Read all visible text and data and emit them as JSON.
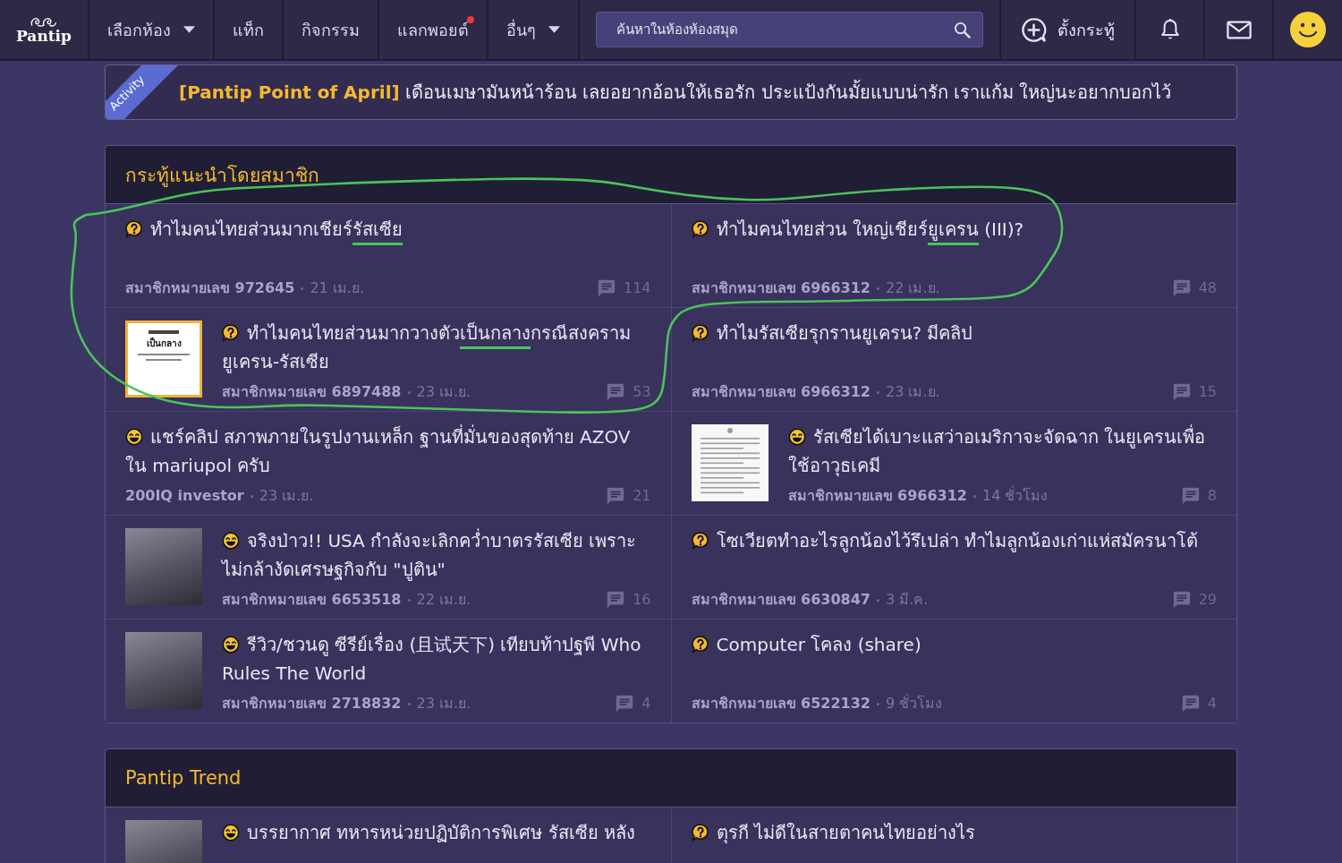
{
  "nav": {
    "logo": "Pantip",
    "items": [
      {
        "label": "เลือกห้อง",
        "dropdown": true,
        "notification": false
      },
      {
        "label": "แท็ก",
        "dropdown": false,
        "notification": false
      },
      {
        "label": "กิจกรรม",
        "dropdown": false,
        "notification": false
      },
      {
        "label": "แลกพอยต์",
        "dropdown": false,
        "notification": true
      },
      {
        "label": "อื่นๆ",
        "dropdown": true,
        "notification": false
      }
    ],
    "search": {
      "placeholder": "ค้นหาในห้องห้องสมุด"
    },
    "new_post": "ตั้งกระทู้"
  },
  "banner": {
    "ribbon": "Activity",
    "text": "**[Pantip Point of April]** เดือนเมษามันหน้าร้อน เลยอยากอ้อนให้เธอรัก ประแป้งกันมั้ยแบบน่ารัก เราแก้ม ใหญ่นะอยากบอกไว้"
  },
  "sections": [
    {
      "title": "กระทู้แนะนำโดยสมาชิก",
      "hand_drawn_loop": true,
      "posts": [
        {
          "kind": "question",
          "title": [
            {
              "text": "ทำไมคนไทยส่วนมากเชียร์",
              "underlined": false
            },
            {
              "text": "รัสเซีย",
              "underlined": true
            }
          ],
          "author": "สมาชิกหมายเลข 972645",
          "time": "21 เม.ย.",
          "comments": "114"
        },
        {
          "kind": "question",
          "title": [
            {
              "text": "ทำไมคนไทยส่วน ใหญ่เชียร์",
              "underlined": false
            },
            {
              "text": "ยูเครน",
              "underlined": true
            },
            {
              "text": " (III)?",
              "underlined": false
            }
          ],
          "author": "สมาชิกหมายเลข 6966312",
          "time": "22 เม.ย.",
          "comments": "48"
        },
        {
          "kind": "question",
          "thumbnail": {
            "kind": "poster",
            "heading": "เป็นกลาง"
          },
          "title": [
            {
              "text": "ทำไมคนไทยส่วนมากวางตัว",
              "underlined": false
            },
            {
              "text": "เป็นกลาง",
              "underlined": true
            },
            {
              "text": "กรณีสงครามยูเครน-รัสเซีย",
              "underlined": false
            }
          ],
          "author": "สมาชิกหมายเลข 6897488",
          "time": "23 เม.ย.",
          "comments": "53"
        },
        {
          "kind": "question",
          "title": [
            {
              "text": "ทำไมรัสเซียรุกรานยูเครน? มีคลิป",
              "underlined": false
            }
          ],
          "author": "สมาชิกหมายเลข 6966312",
          "time": "23 เม.ย.",
          "comments": "15"
        },
        {
          "kind": "chat",
          "title": [
            {
              "text": "แชร์คลิป สภาพภายในรูปงานเหล็ก ฐานที่มั่นของสุดท้าย AZOV ใน mariupol ครับ",
              "underlined": false
            }
          ],
          "author": "200IQ investor",
          "time": "23 เม.ย.",
          "comments": "21"
        },
        {
          "kind": "chat",
          "thumbnail": {
            "kind": "document"
          },
          "title": [
            {
              "text": "รัสเซียได้เบาะแสว่าอเมริกาจะจัดฉาก ในยูเครนเพื่อใช้อาวุธเคมี",
              "underlined": false
            }
          ],
          "author": "สมาชิกหมายเลข 6966312",
          "time": "14 ชั่วโมง",
          "comments": "8"
        },
        {
          "kind": "chat",
          "thumbnail": {
            "kind": "photo"
          },
          "title": [
            {
              "text": "จริงป่าว!! USA กำลังจะเลิกคว่ำบาตรรัสเซีย เพราะไม่กล้างัดเศรษฐกิจกับ \"ปูติน\"",
              "underlined": false
            }
          ],
          "author": "สมาชิกหมายเลข 6653518",
          "time": "22 เม.ย.",
          "comments": "16"
        },
        {
          "kind": "question",
          "title": [
            {
              "text": "โซเวียตทำอะไรลูกน้องไว้รึเปล่า ทำไมลูกน้องเก่าแห่สมัครนาโต้",
              "underlined": false
            }
          ],
          "author": "สมาชิกหมายเลข 6630847",
          "time": "3 มี.ค.",
          "comments": "29"
        },
        {
          "kind": "chat",
          "thumbnail": {
            "kind": "photo"
          },
          "title": [
            {
              "text": "รีวิว/ชวนดู ซีรีย์เรื่อง (且试天下) เทียบท้าปฐพี Who Rules The World",
              "underlined": false
            }
          ],
          "author": "สมาชิกหมายเลข 2718832",
          "time": "23 เม.ย.",
          "comments": "4"
        },
        {
          "kind": "question",
          "title": [
            {
              "text": "Computer โคลง (share)",
              "underlined": false
            }
          ],
          "author": "สมาชิกหมายเลข 6522132",
          "time": "9 ชั่วโมง",
          "comments": "4"
        }
      ]
    },
    {
      "title": "Pantip Trend",
      "hand_drawn_loop": false,
      "posts": [
        {
          "kind": "chat",
          "thumbnail": {
            "kind": "photo"
          },
          "title": [
            {
              "text": "บรรยากาศ ทหารหน่วยปฏิบัติการพิเศษ รัสเซีย หลัง",
              "underlined": false
            }
          ]
        },
        {
          "kind": "question",
          "title": [
            {
              "text": "ตุรกี ไม่ดีในสายตาคนไทยอย่างไร",
              "underlined": false
            }
          ]
        }
      ]
    }
  ]
}
